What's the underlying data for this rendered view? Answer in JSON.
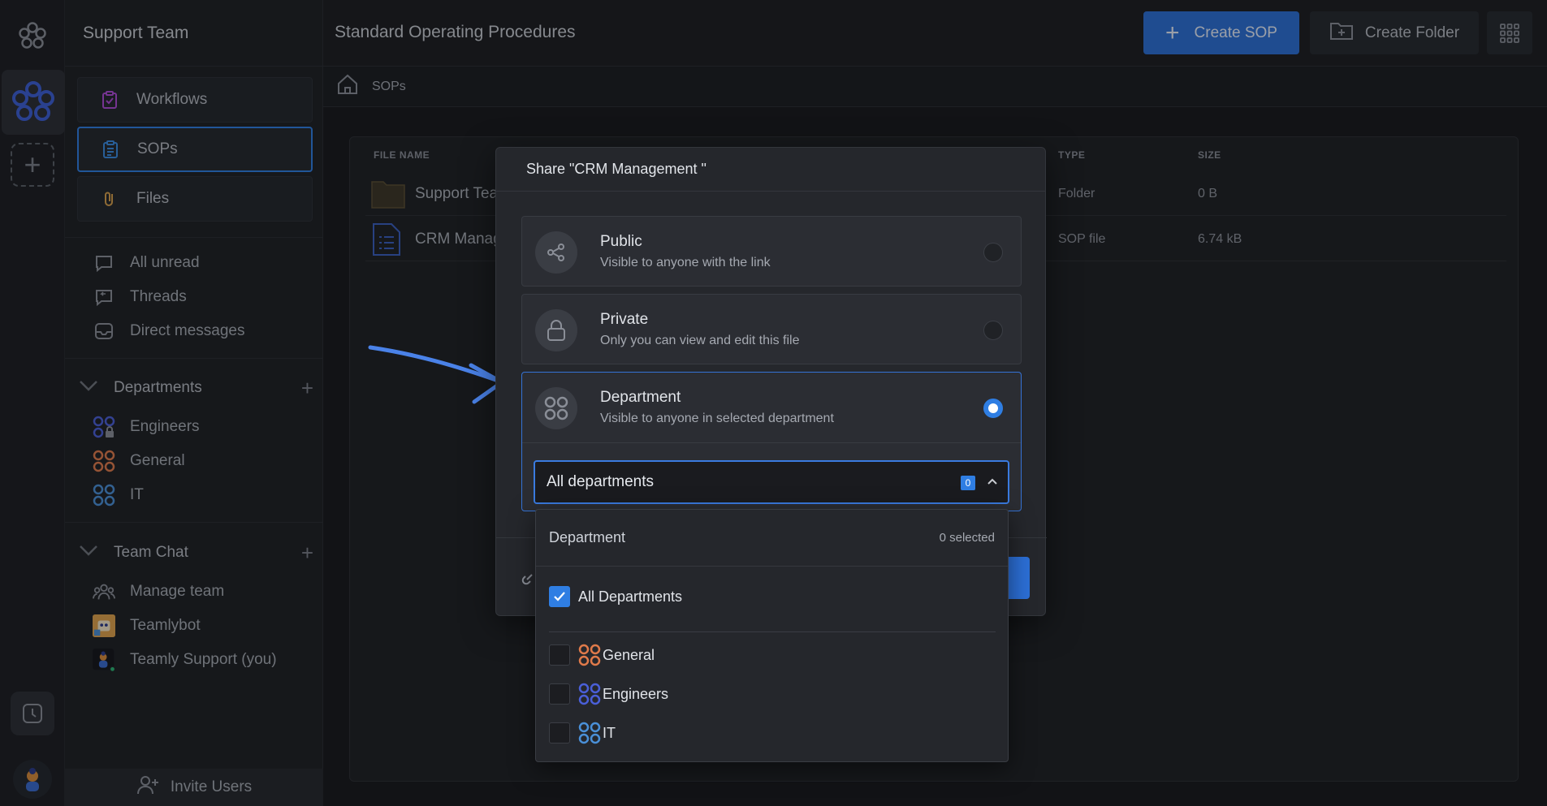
{
  "sidebar": {
    "workspace_title": "Support Team",
    "nav": [
      {
        "label": "Workflows",
        "icon": "clipboard-check-icon"
      },
      {
        "label": "SOPs",
        "icon": "clipboard-list-icon"
      },
      {
        "label": "Files",
        "icon": "paperclip-icon"
      }
    ],
    "inbox": [
      {
        "label": "All unread",
        "icon": "chat-bubble-icon"
      },
      {
        "label": "Threads",
        "icon": "thread-icon"
      },
      {
        "label": "Direct messages",
        "icon": "inbox-icon"
      }
    ],
    "departments": {
      "title": "Departments",
      "items": [
        {
          "label": "Engineers",
          "color": "#4a5fd8"
        },
        {
          "label": "General",
          "color": "#e07a4a"
        },
        {
          "label": "IT",
          "color": "#4a90d8"
        }
      ]
    },
    "team_chat": {
      "title": "Team Chat",
      "items": [
        {
          "label": "Manage team",
          "icon": "team-icon"
        },
        {
          "label": "Teamlybot",
          "icon": "bot-avatar"
        },
        {
          "label": "Teamly Support (you)",
          "icon": "user-avatar"
        }
      ]
    },
    "invite_label": "Invite Users"
  },
  "topbar": {
    "title": "Standard Operating Procedures",
    "create_sop": "Create SOP",
    "create_folder": "Create Folder"
  },
  "breadcrumb": {
    "label": "SOPs"
  },
  "table": {
    "headers": {
      "file_name": "FILE NAME",
      "type": "TYPE",
      "size": "SIZE"
    },
    "rows": [
      {
        "name": "Support Tea",
        "type": "Folder",
        "size": "0 B",
        "icon": "folder-icon"
      },
      {
        "name": "CRM Manag",
        "type": "SOP file",
        "size": "6.74 kB",
        "icon": "document-icon"
      }
    ]
  },
  "modal": {
    "title": "Share \"CRM Management \"",
    "options": [
      {
        "title": "Public",
        "desc": "Visible to anyone with the link",
        "icon": "share-icon",
        "selected": false
      },
      {
        "title": "Private",
        "desc": "Only you can view and edit this file",
        "icon": "lock-icon",
        "selected": false
      },
      {
        "title": "Department",
        "desc": "Visible to anyone in selected department",
        "icon": "department-icon",
        "selected": true
      }
    ],
    "select_value": "All departments",
    "select_count": "0"
  },
  "dropdown": {
    "header": "Department",
    "selected_text": "0 selected",
    "all_label": "All Departments",
    "all_checked": true,
    "items": [
      {
        "label": "General",
        "color": "#e07a4a",
        "checked": false
      },
      {
        "label": "Engineers",
        "color": "#4a5fd8",
        "checked": false
      },
      {
        "label": "IT",
        "color": "#4a90d8",
        "checked": false
      }
    ]
  },
  "colors": {
    "accent": "#2f7ee3",
    "arrow": "#4a82e8"
  }
}
